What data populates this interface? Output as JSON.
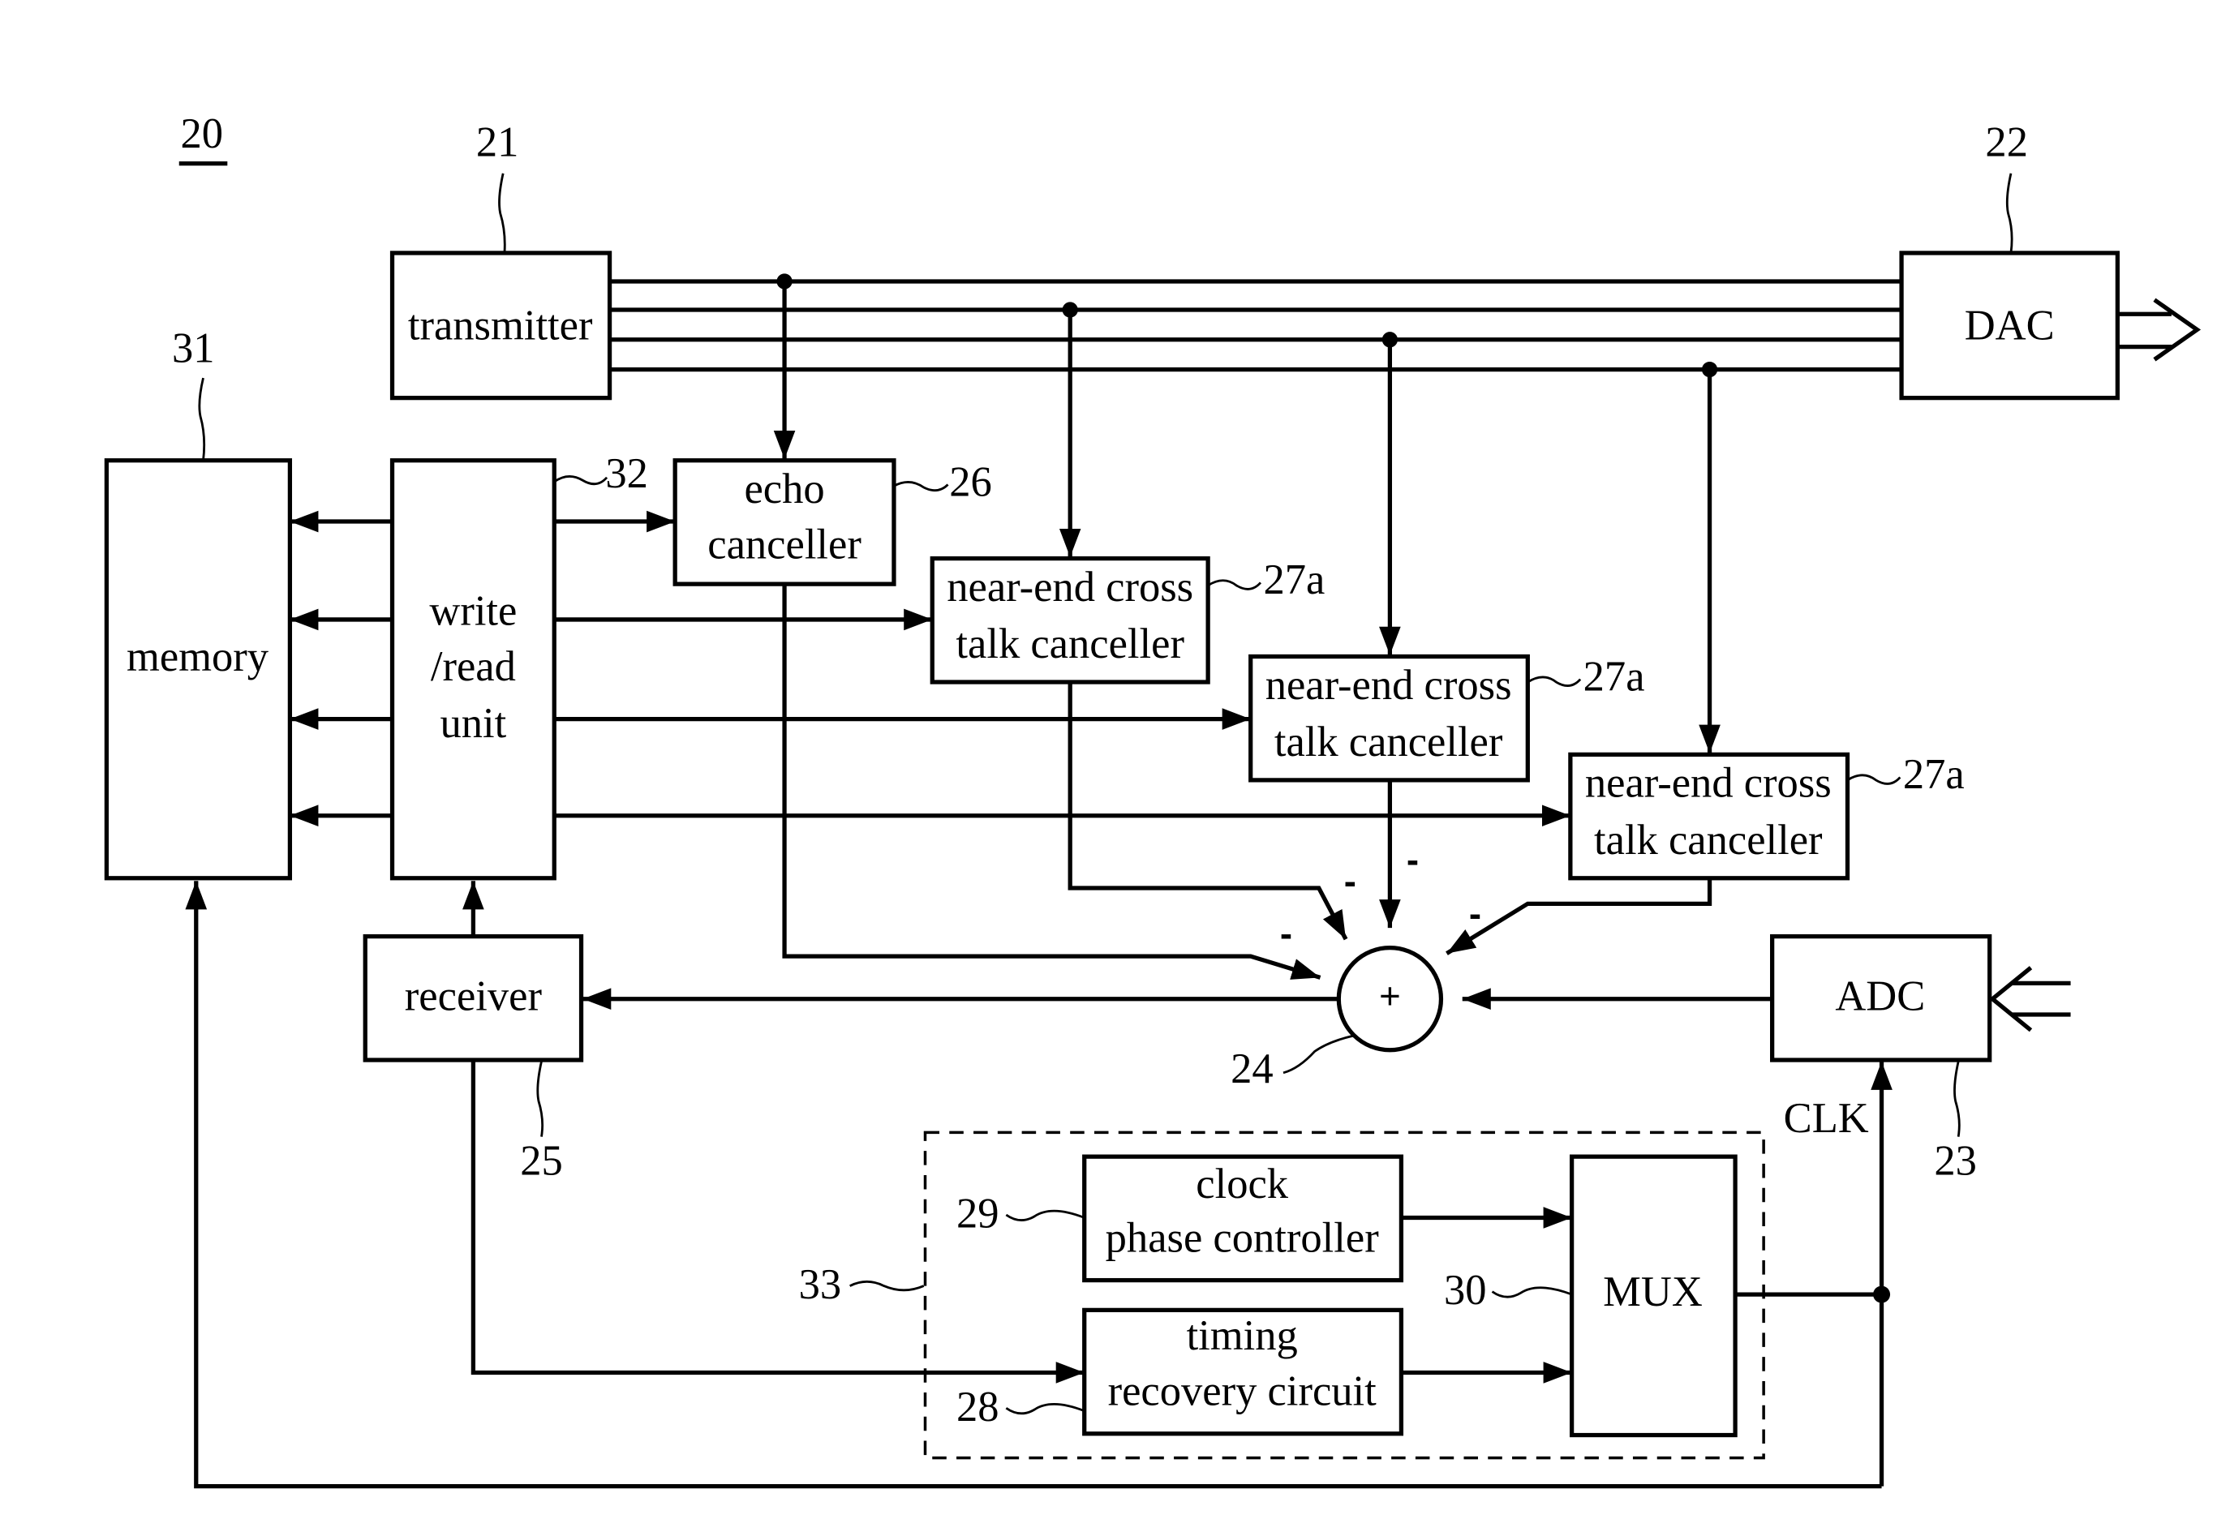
{
  "figure": {
    "ref": "20",
    "colors": {
      "line": "#000000",
      "background": "#ffffff"
    }
  },
  "blocks": {
    "transmitter": {
      "ref": "21",
      "lines": [
        "transmitter"
      ]
    },
    "dac": {
      "ref": "22",
      "lines": [
        "DAC"
      ]
    },
    "adc": {
      "ref": "23",
      "lines": [
        "ADC"
      ]
    },
    "summer": {
      "ref": "24",
      "symbol": "+"
    },
    "receiver": {
      "ref": "25",
      "lines": [
        "receiver"
      ]
    },
    "echo_canceller": {
      "ref": "26",
      "lines": [
        "echo",
        "canceller"
      ]
    },
    "next_canceller_1": {
      "ref": "27a",
      "lines": [
        "near-end cross",
        "talk canceller"
      ]
    },
    "next_canceller_2": {
      "ref": "27a",
      "lines": [
        "near-end cross",
        "talk canceller"
      ]
    },
    "next_canceller_3": {
      "ref": "27a",
      "lines": [
        "near-end cross",
        "talk canceller"
      ]
    },
    "timing_recovery": {
      "ref": "28",
      "lines": [
        "timing",
        "recovery circuit"
      ]
    },
    "clock_phase_controller": {
      "ref": "29",
      "lines": [
        "clock",
        "phase controller"
      ]
    },
    "mux": {
      "ref": "30",
      "lines": [
        "MUX"
      ]
    },
    "memory": {
      "ref": "31",
      "lines": [
        "memory"
      ]
    },
    "write_read_unit": {
      "ref": "32",
      "lines": [
        "write",
        "/read",
        "unit"
      ]
    },
    "clock_group": {
      "ref": "33"
    }
  },
  "signals": {
    "clk_label": "CLK",
    "summer_input_signs": [
      "-",
      "-",
      "-",
      "-"
    ]
  }
}
